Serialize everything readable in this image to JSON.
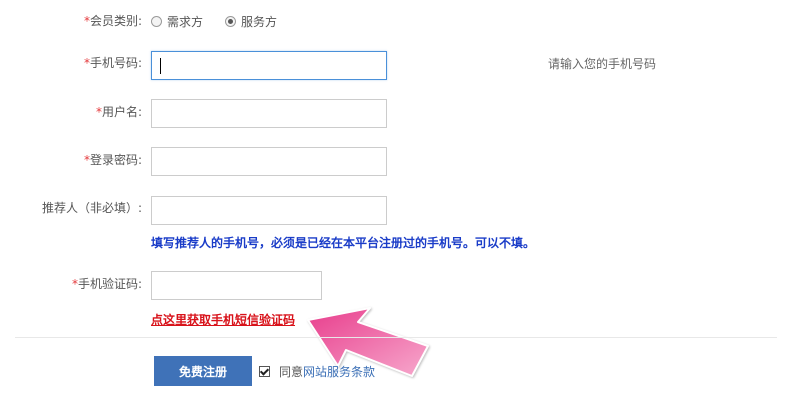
{
  "form": {
    "member_type": {
      "required_mark": "*",
      "label": "会员类别:",
      "options": [
        {
          "label": "需求方",
          "checked": false
        },
        {
          "label": "服务方",
          "checked": true
        }
      ]
    },
    "phone": {
      "required_mark": "*",
      "label": "手机号码:",
      "value": "",
      "hint": "请输入您的手机号码"
    },
    "username": {
      "required_mark": "*",
      "label": "用户名:",
      "value": ""
    },
    "password": {
      "required_mark": "*",
      "label": "登录密码:",
      "value": ""
    },
    "referrer": {
      "label": "推荐人（非必填）:",
      "value": "",
      "hint": "填写推荐人的手机号，必须是已经在本平台注册过的手机号。可以不填。"
    },
    "sms_code": {
      "required_mark": "*",
      "label": "手机验证码:",
      "value": "",
      "link": "点这里获取手机短信验证码"
    }
  },
  "submit": {
    "label": "免费注册"
  },
  "agreement": {
    "checked": true,
    "prefix": "同意",
    "link": "网站服务条款"
  },
  "colors": {
    "required": "#e4393c",
    "button": "#3f72b8",
    "hint_blue": "#1a3cc8",
    "sms_link": "#d8121a",
    "arrow_pink": "#f06aa6"
  },
  "icons": {
    "pointer_arrow": "pink-arrow-icon"
  }
}
